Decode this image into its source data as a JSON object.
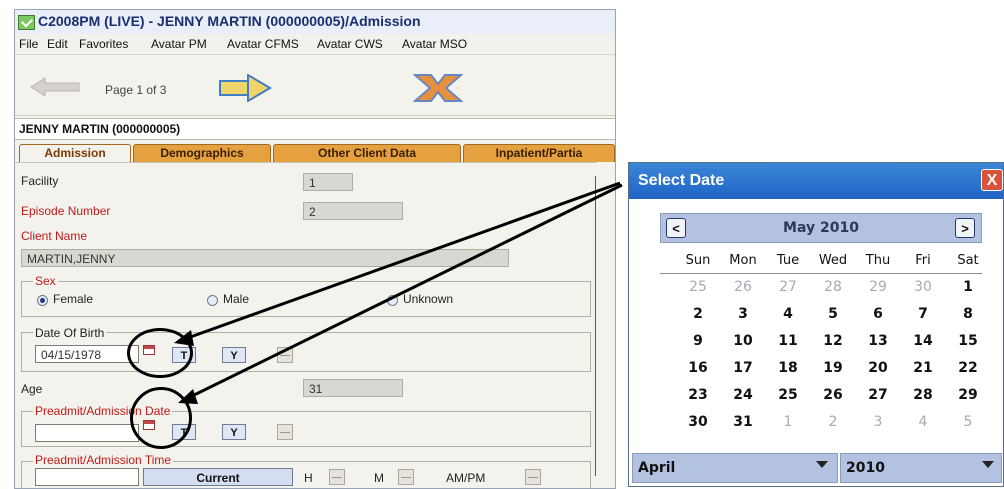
{
  "window": {
    "title": "C2008PM (LIVE) - JENNY MARTIN (000000005)/Admission"
  },
  "menu": [
    "File",
    "Edit",
    "Favorites",
    "Avatar PM",
    "Avatar CFMS",
    "Avatar CWS",
    "Avatar MSO"
  ],
  "toolbar": {
    "page_label": "Page 1 of 3",
    "back_icon": "left-arrow-icon",
    "next_icon": "right-arrow-icon",
    "close_icon": "x-close-icon"
  },
  "client": "JENNY MARTIN (000000005)",
  "tabs": [
    "Admission",
    "Demographics",
    "Other Client Data",
    "Inpatient/Partia"
  ],
  "form": {
    "facility_label": "Facility",
    "facility_value": "1",
    "episode_label": "Episode Number",
    "episode_value": "2",
    "client_name_label": "Client Name",
    "client_name_value": "MARTIN,JENNY",
    "sex_label": "Sex",
    "sex_options": [
      "Female",
      "Male",
      "Unknown"
    ],
    "sex_selected": "Female",
    "dob_label": "Date Of Birth",
    "dob_value": "04/15/1978",
    "t_btn": "T",
    "y_btn": "Y",
    "age_label": "Age",
    "age_value": "31",
    "preadmit_date_label": "Preadmit/Admission Date",
    "preadmit_date_value": "",
    "preadmit_time_label": "Preadmit/Admission Time",
    "current_btn": "Current",
    "h_label": "H",
    "m_label": "M",
    "ampm_label": "AM/PM"
  },
  "date_picker": {
    "title": "Select Date",
    "close_glyph": "X",
    "month_label": "May 2010",
    "prev_glyph": "<",
    "next_glyph": ">",
    "weekdays": [
      "Sun",
      "Mon",
      "Tue",
      "Wed",
      "Thu",
      "Fri",
      "Sat"
    ],
    "weeks": [
      [
        "25",
        "26",
        "27",
        "28",
        "29",
        "30",
        "1"
      ],
      [
        "2",
        "3",
        "4",
        "5",
        "6",
        "7",
        "8"
      ],
      [
        "9",
        "10",
        "11",
        "12",
        "13",
        "14",
        "15"
      ],
      [
        "16",
        "17",
        "18",
        "19",
        "20",
        "21",
        "22"
      ],
      [
        "23",
        "24",
        "25",
        "26",
        "27",
        "28",
        "29"
      ],
      [
        "30",
        "31",
        "1",
        "2",
        "3",
        "4",
        "5"
      ]
    ],
    "muted": [
      [
        true,
        true,
        true,
        true,
        true,
        true,
        false
      ],
      [
        false,
        false,
        false,
        false,
        false,
        false,
        false
      ],
      [
        false,
        false,
        false,
        false,
        false,
        false,
        false
      ],
      [
        false,
        false,
        false,
        false,
        false,
        false,
        false
      ],
      [
        false,
        false,
        false,
        false,
        false,
        false,
        false
      ],
      [
        false,
        false,
        true,
        true,
        true,
        true,
        true
      ]
    ],
    "month_select": "April",
    "year_select": "2010"
  },
  "colors": {
    "tab_orange": "#e5a13f",
    "title_navy": "#1b2f6e",
    "required_red": "#c11a1a",
    "popup_blue": "#1f64c6"
  }
}
